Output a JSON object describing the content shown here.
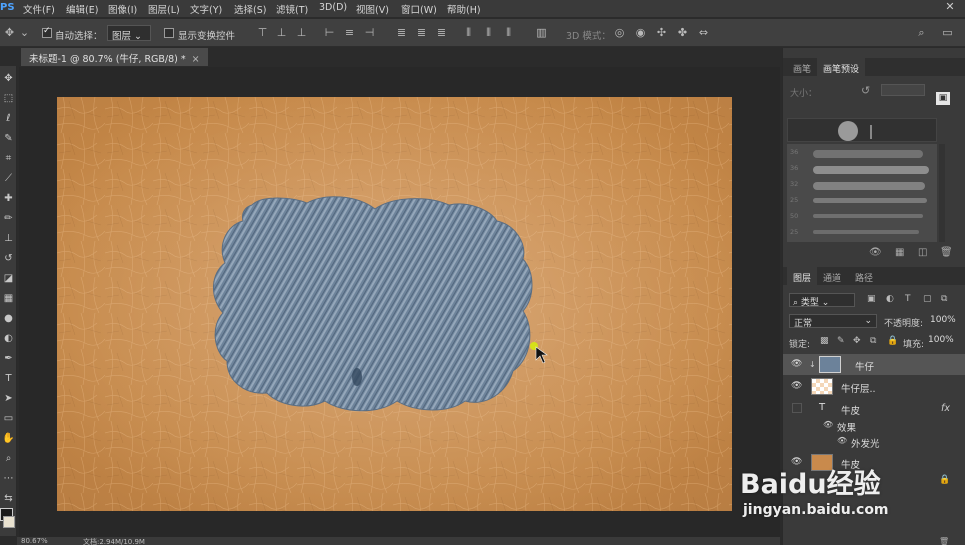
{
  "menu": {
    "logo": "PS",
    "items": [
      "文件(F)",
      "编辑(E)",
      "图像(I)",
      "图层(L)",
      "文字(Y)",
      "选择(S)",
      "滤镜(T)",
      "3D(D)",
      "视图(V)",
      "窗口(W)",
      "帮助(H)"
    ]
  },
  "options": {
    "auto_select_label": "自动选择：",
    "auto_select_value": "图层",
    "show_transform_label": "显示变换控件",
    "mode_3d_label": "3D 模式："
  },
  "document": {
    "tab_title": "未标题-1 @ 80.7% (牛仔, RGB/8) *",
    "close_glyph": "×"
  },
  "status": {
    "zoom": "80.67%",
    "doc_size": "文档:2.94M/10.9M"
  },
  "brush_panel": {
    "tabs": [
      "画笔",
      "画笔预设"
    ],
    "size_label": "大小：",
    "stroke_numbers": [
      "36",
      "36",
      "32",
      "25",
      "50",
      "25"
    ]
  },
  "layers_panel": {
    "tabs": [
      "图层",
      "通道",
      "路径"
    ],
    "filter_label": "类型",
    "blend_mode": "正常",
    "opacity_label": "不透明度:",
    "opacity_value": "100%",
    "lock_label": "锁定:",
    "fill_label": "填充:",
    "fill_value": "100%",
    "layers": [
      {
        "name": "牛仔",
        "selected": true
      },
      {
        "name": "牛仔层..",
        "selected": false
      },
      {
        "name": "牛皮",
        "selected": false
      },
      {
        "name": "效果",
        "selected": false
      },
      {
        "name": "外发光",
        "selected": false
      },
      {
        "name": "牛皮",
        "selected": false
      }
    ],
    "fx_label": "fx"
  },
  "watermark": {
    "brand": "Baidu经验",
    "url": "jingyan.baidu.com"
  },
  "colors": {
    "leather": "#c98a4c",
    "denim": "#6c829a",
    "accent": "#4da3ff"
  }
}
